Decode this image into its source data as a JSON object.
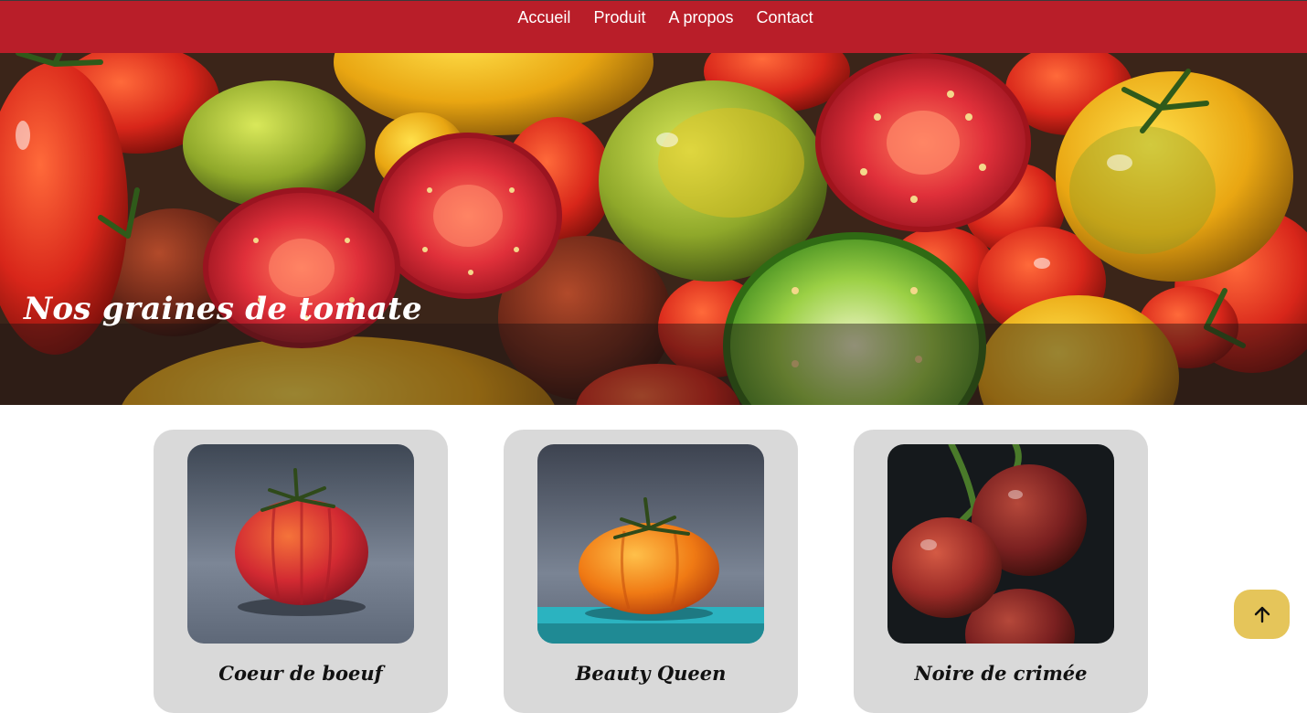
{
  "nav": {
    "links": [
      "Accueil",
      "Produit",
      "A propos",
      "Contact"
    ]
  },
  "hero": {
    "title": "Nos graines de tomate"
  },
  "products": [
    {
      "name": "Coeur de boeuf"
    },
    {
      "name": "Beauty Queen"
    },
    {
      "name": "Noire de crimée"
    }
  ],
  "scroll_top": {
    "icon": "arrow-up-icon"
  },
  "colors": {
    "navbar": "#b91e29",
    "card_bg": "#d9d9d9",
    "scroll_button": "#e5c55a"
  }
}
